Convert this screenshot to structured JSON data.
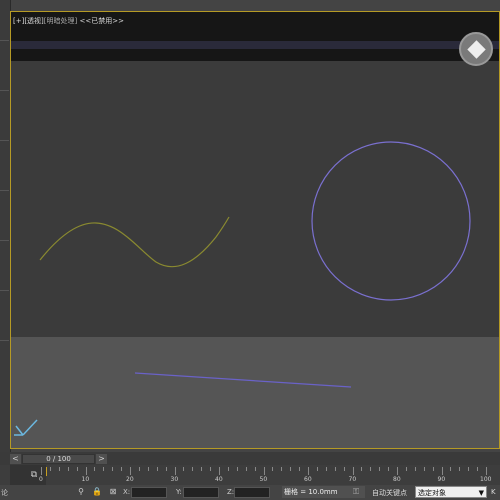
{
  "viewport": {
    "label_plus": "[+]",
    "label_view": "[透视]",
    "label_shading": "[明暗处理]",
    "label_disabled": "<<已禁用>>"
  },
  "timeline": {
    "frame_text": "0 / 100",
    "prev_label": "<",
    "next_label": ">"
  },
  "ruler": {
    "ticks": [
      "0",
      "10",
      "20",
      "30",
      "40",
      "50",
      "60",
      "70",
      "80",
      "90",
      "100"
    ]
  },
  "status": {
    "left_glyph": "论",
    "x_label": "X:",
    "y_label": "Y:",
    "z_label": "Z:",
    "grid_text": "栅格 = 10.0mm",
    "autokey_label": "自动关键点",
    "selection_value": "选定对象",
    "k_label": "K"
  },
  "colors": {
    "viewport_border": "#b59a25",
    "curve_yellow": "#8a8a30",
    "circle_purple": "#7a70d0",
    "line_purple": "#6a62c8"
  }
}
